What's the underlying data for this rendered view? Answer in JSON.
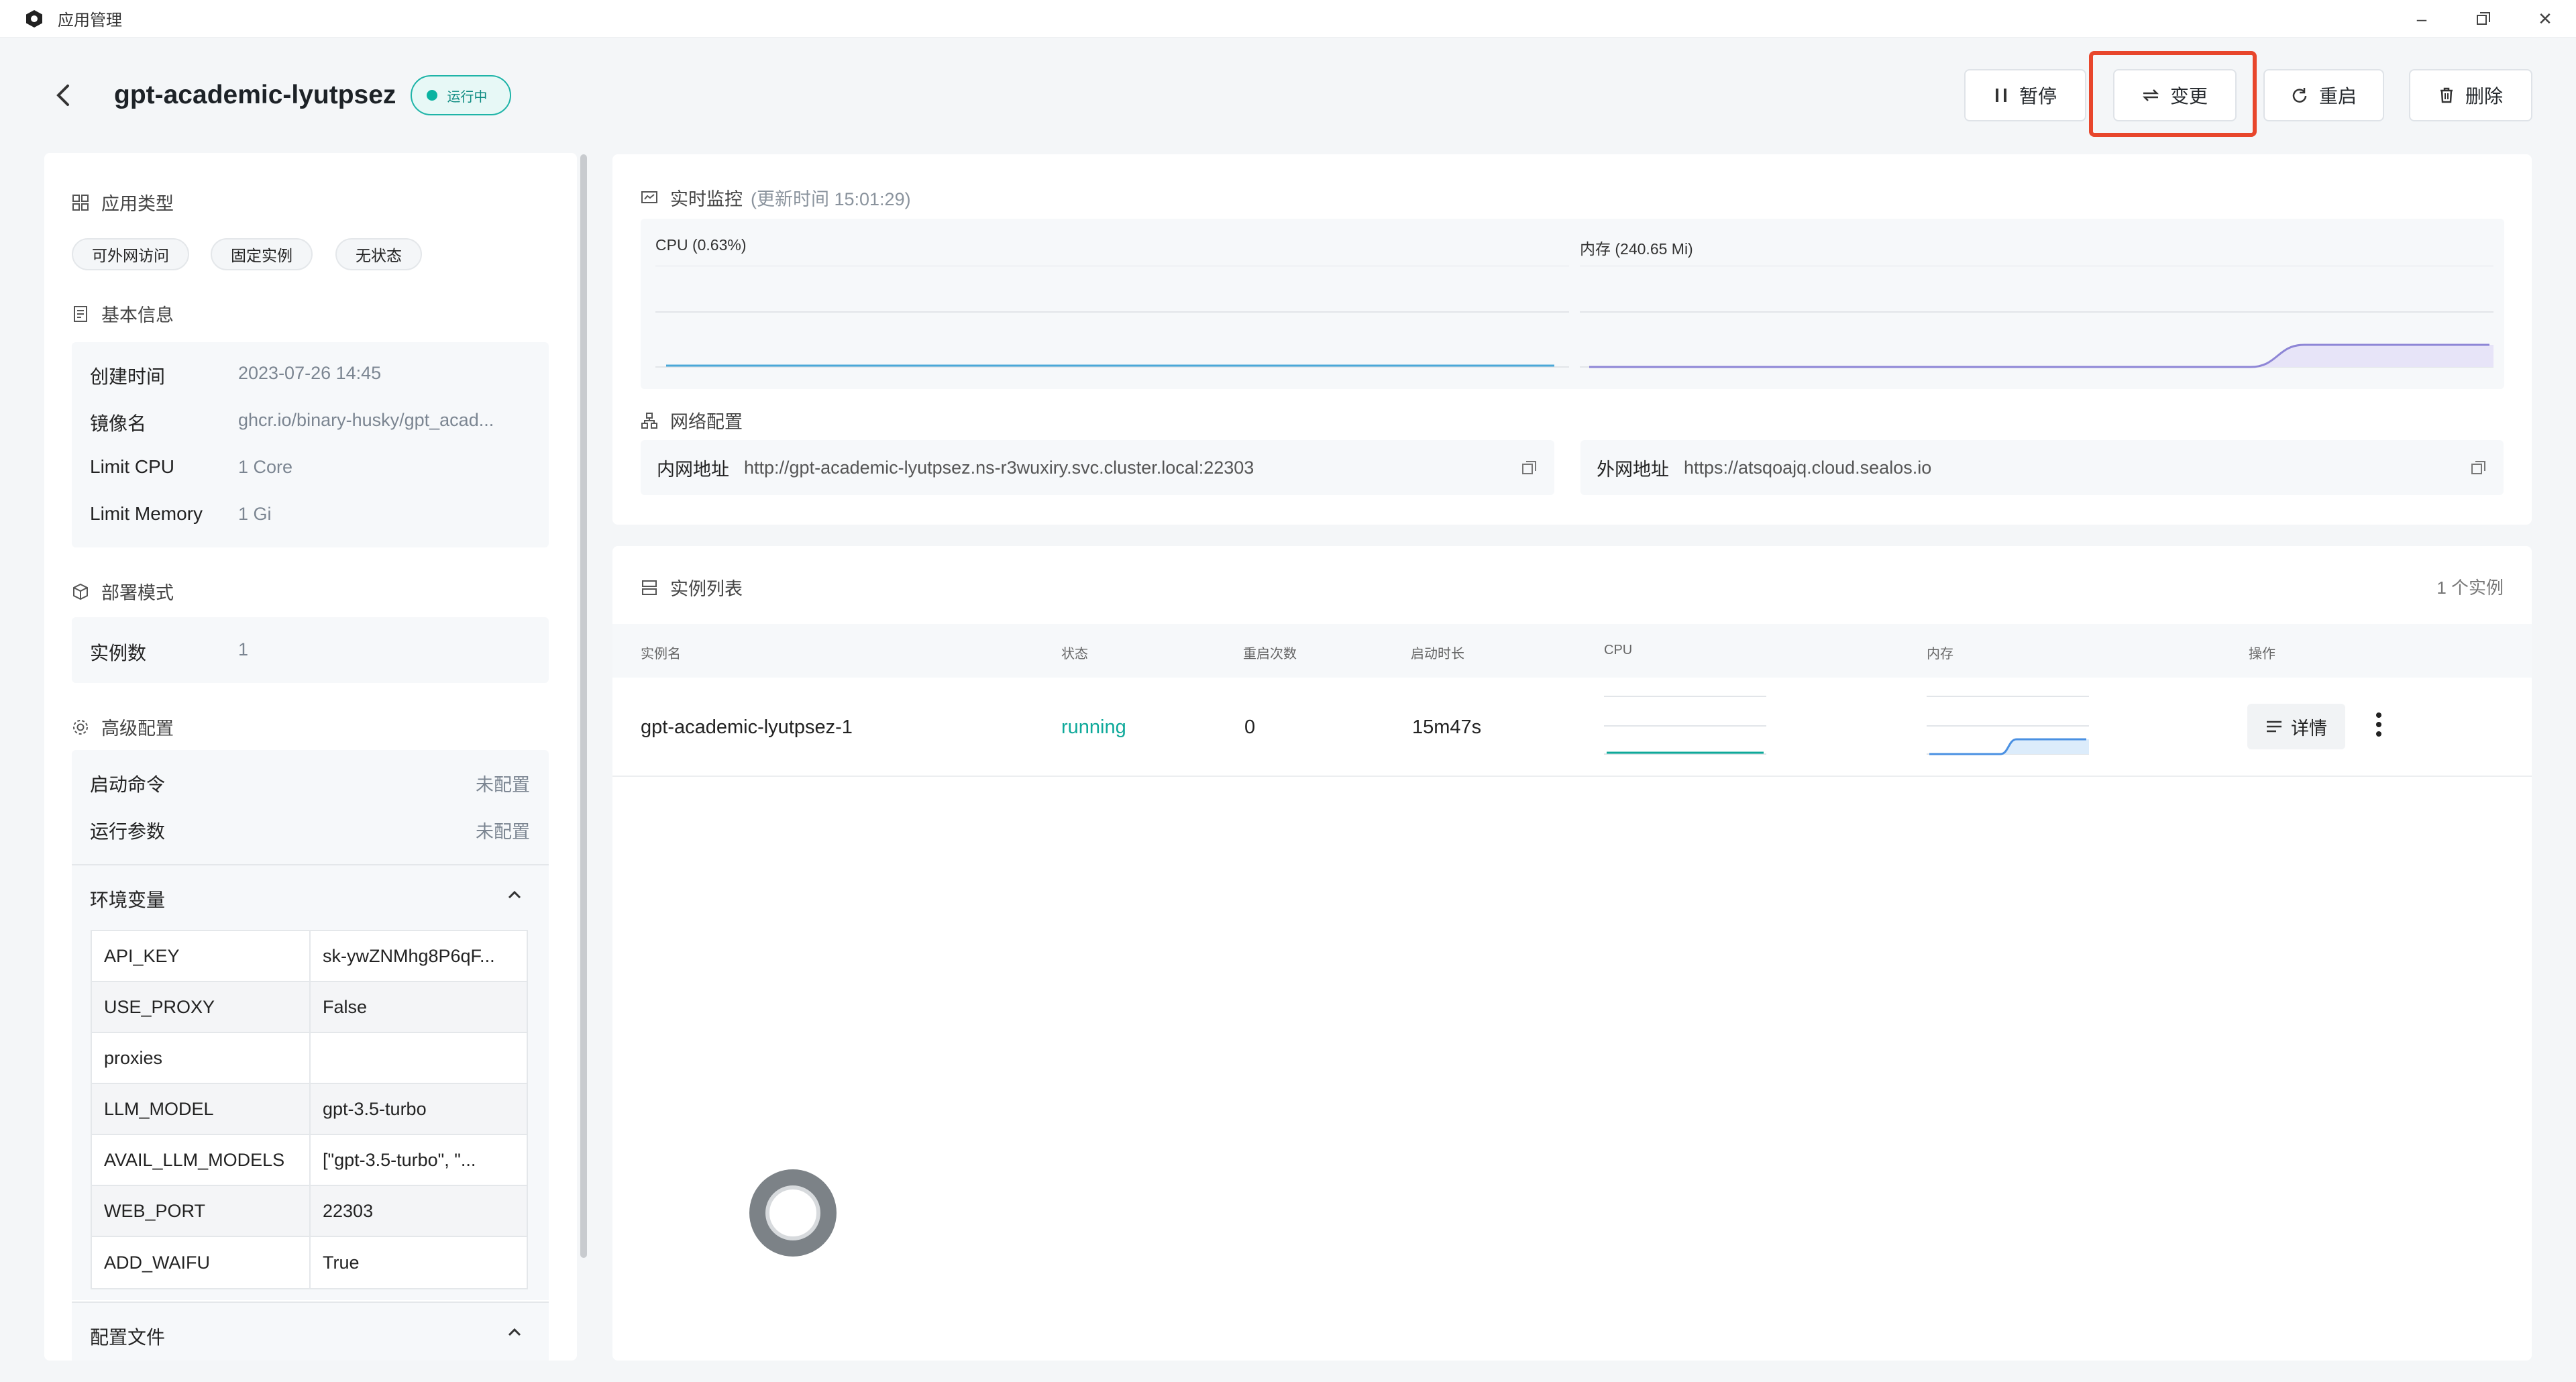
{
  "window": {
    "title": "应用管理",
    "minimize_icon": "minimize-icon",
    "restore_icon": "restore-icon",
    "close_icon": "close-icon"
  },
  "header": {
    "app_name": "gpt-academic-lyutpsez",
    "status": "运行中"
  },
  "actions": {
    "pause": "暂停",
    "change": "变更",
    "restart": "重启",
    "delete": "删除"
  },
  "sidebar": {
    "app_type": {
      "title": "应用类型",
      "tags": [
        "可外网访问",
        "固定实例",
        "无状态"
      ]
    },
    "basic_info": {
      "title": "基本信息",
      "rows": [
        {
          "k": "创建时间",
          "v": "2023-07-26 14:45"
        },
        {
          "k": "镜像名",
          "v": "ghcr.io/binary-husky/gpt_acad..."
        },
        {
          "k": "Limit CPU",
          "v": "1 Core"
        },
        {
          "k": "Limit Memory",
          "v": "1 Gi"
        }
      ]
    },
    "deploy": {
      "title": "部署模式",
      "k": "实例数",
      "v": "1"
    },
    "advanced": {
      "title": "高级配置",
      "startup_cmd": {
        "k": "启动命令",
        "v": "未配置"
      },
      "run_args": {
        "k": "运行参数",
        "v": "未配置"
      },
      "env_title": "环境变量",
      "env": [
        {
          "k": "API_KEY",
          "v": "sk-ywZNMhg8P6qF..."
        },
        {
          "k": "USE_PROXY",
          "v": "False"
        },
        {
          "k": "proxies",
          "v": ""
        },
        {
          "k": "LLM_MODEL",
          "v": "gpt-3.5-turbo"
        },
        {
          "k": "AVAIL_LLM_MODELS",
          "v": "[\"gpt-3.5-turbo\", \"..."
        },
        {
          "k": "WEB_PORT",
          "v": "22303"
        },
        {
          "k": "ADD_WAIFU",
          "v": "True"
        }
      ],
      "config_file_title": "配置文件"
    }
  },
  "monitor": {
    "title": "实时监控",
    "updated": "(更新时间 15:01:29)",
    "cpu_label": "CPU  (0.63%)",
    "mem_label": "内存  (240.65 Mi)"
  },
  "network": {
    "title": "网络配置",
    "internal_label": "内网地址",
    "internal_url": "http://gpt-academic-lyutpsez.ns-r3wuxiry.svc.cluster.local:22303",
    "external_label": "外网地址",
    "external_url": "https://atsqoajq.cloud.sealos.io"
  },
  "instances": {
    "title": "实例列表",
    "count": "1 个实例",
    "columns": [
      "实例名",
      "状态",
      "重启次数",
      "启动时长",
      "CPU",
      "内存",
      "操作"
    ],
    "rows": [
      {
        "name": "gpt-academic-lyutpsez-1",
        "status": "running",
        "restarts": "0",
        "uptime": "15m47s",
        "detail": "详情"
      }
    ]
  },
  "colors": {
    "accent": "#0bb3a1",
    "highlight": "#e8462c",
    "cpu_line": "#4aa8d8",
    "mem_line": "#8e86d6"
  }
}
